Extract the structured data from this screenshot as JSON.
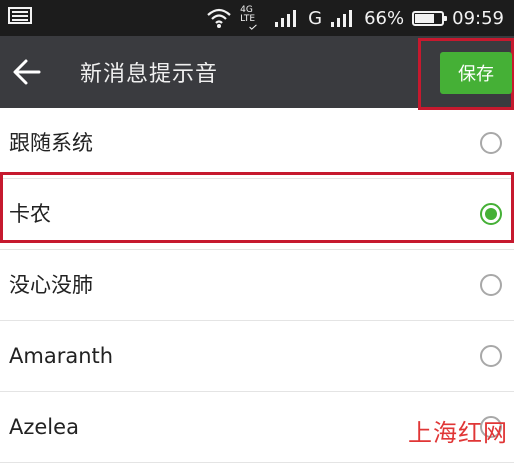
{
  "status_bar": {
    "network_label": "4G LTE",
    "carrier_label": "G",
    "battery_text": "66%",
    "battery_level": 0.66,
    "time": "09:59",
    "icons": [
      "image-notification-icon",
      "wifi-icon",
      "signal-icon",
      "battery-icon"
    ]
  },
  "app_bar": {
    "title": "新消息提示音",
    "back_icon": "back-arrow-icon",
    "save_label": "保存"
  },
  "tones": [
    {
      "label": "跟随系统",
      "selected": false
    },
    {
      "label": "卡农",
      "selected": true
    },
    {
      "label": "没心没肺",
      "selected": false
    },
    {
      "label": "Amaranth",
      "selected": false
    },
    {
      "label": "Azelea",
      "selected": false
    }
  ],
  "watermark": "上海红网",
  "colors": {
    "app_bar": "#3a3b3f",
    "accent_green": "#45b036",
    "highlight_red": "#c6192e"
  }
}
